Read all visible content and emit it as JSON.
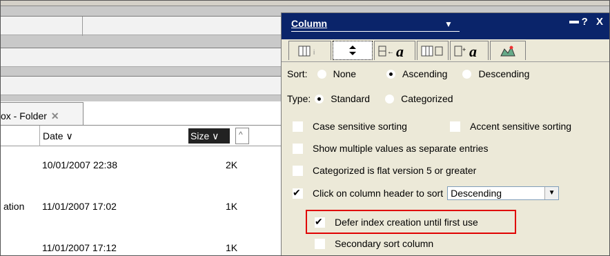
{
  "folder_tab": {
    "label": "ox - Folder",
    "close_glyph": "✕"
  },
  "list": {
    "headers": {
      "date": "Date ∨",
      "size": "Size ∨",
      "sort_up": "^"
    },
    "rows": [
      {
        "left": "",
        "date": "10/01/2007 22:38",
        "size": "2K"
      },
      {
        "left": "ation",
        "date": "11/01/2007 17:02",
        "size": "1K"
      },
      {
        "left": "",
        "date": "11/01/2007 17:12",
        "size": "1K"
      }
    ]
  },
  "panel": {
    "title": "Column",
    "title_dropdown_glyph": "▼",
    "title_tools": "? X",
    "tabs": [
      {
        "icon": "column-info-icon",
        "active": false
      },
      {
        "icon": "sorting-icon",
        "active": true
      },
      {
        "icon": "font-icon",
        "active": false
      },
      {
        "icon": "column-title-icon",
        "active": false
      },
      {
        "icon": "title-font-icon",
        "active": false
      },
      {
        "icon": "advanced-icon",
        "active": false
      }
    ],
    "sort": {
      "label": "Sort:",
      "options": [
        "None",
        "Ascending",
        "Descending"
      ],
      "selected": "Ascending"
    },
    "type": {
      "label": "Type:",
      "options": [
        "Standard",
        "Categorized"
      ],
      "selected": "Standard"
    },
    "checks": {
      "case_sensitive": "Case sensitive sorting",
      "accent_sensitive": "Accent sensitive sorting",
      "multiple_values": "Show multiple values as separate entries",
      "categorized_flat": "Categorized is flat version 5 or greater",
      "click_header": "Click on column header to sort",
      "click_header_value": "Descending",
      "defer_index": "Defer index creation until first use",
      "secondary_sort": "Secondary sort column"
    }
  },
  "colors": {
    "title_bar": "#0a246a",
    "panel_bg": "#ece9d8",
    "highlight": "#e00000"
  }
}
